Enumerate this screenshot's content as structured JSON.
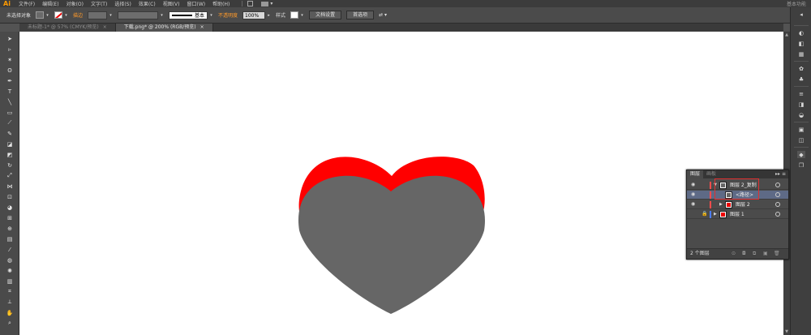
{
  "app": {
    "logo": "Ai"
  },
  "menu": {
    "items": [
      "文件(F)",
      "编辑(E)",
      "对象(O)",
      "文字(T)",
      "选择(S)",
      "效果(C)",
      "视图(V)",
      "窗口(W)",
      "帮助(H)"
    ],
    "workspace": "基本功能"
  },
  "control": {
    "selection_label": "未选择对象",
    "stroke_label": "描边",
    "stroke_style": "基本",
    "opacity_label": "不透明度",
    "opacity_value": "100%",
    "style_label": "样式",
    "doc_setup_button": "文档设置",
    "prefs_button": "首选项"
  },
  "tabs": [
    {
      "label": "未标题-1* @ 57% (CMYK/预览)",
      "close": "×",
      "active": false
    },
    {
      "label": "下载.png* @ 200% (RGB/预览)",
      "close": "×",
      "active": true
    }
  ],
  "canvas": {
    "heart_colors": {
      "back": "#ff0000",
      "front": "#666666"
    }
  },
  "layers_panel": {
    "tabs": [
      "图层",
      "画板"
    ],
    "menu_glyph": "▸▸ ≡",
    "rows": [
      {
        "name": "图层 2_复制",
        "color": "#ff4c4c",
        "selected": false,
        "locked": false,
        "expanded": true
      },
      {
        "name": "<路径>",
        "color": "#ff4c4c",
        "selected": true,
        "locked": false,
        "expanded": false
      },
      {
        "name": "图层 2",
        "color": "#ff4c4c",
        "selected": false,
        "locked": false,
        "expanded": false
      },
      {
        "name": "图层 1",
        "color": "#4c7cff",
        "selected": false,
        "locked": true,
        "expanded": false
      }
    ],
    "count": "2 个图层"
  },
  "colors": {
    "accent": "#ff9a00",
    "highlight": "#e03030"
  }
}
